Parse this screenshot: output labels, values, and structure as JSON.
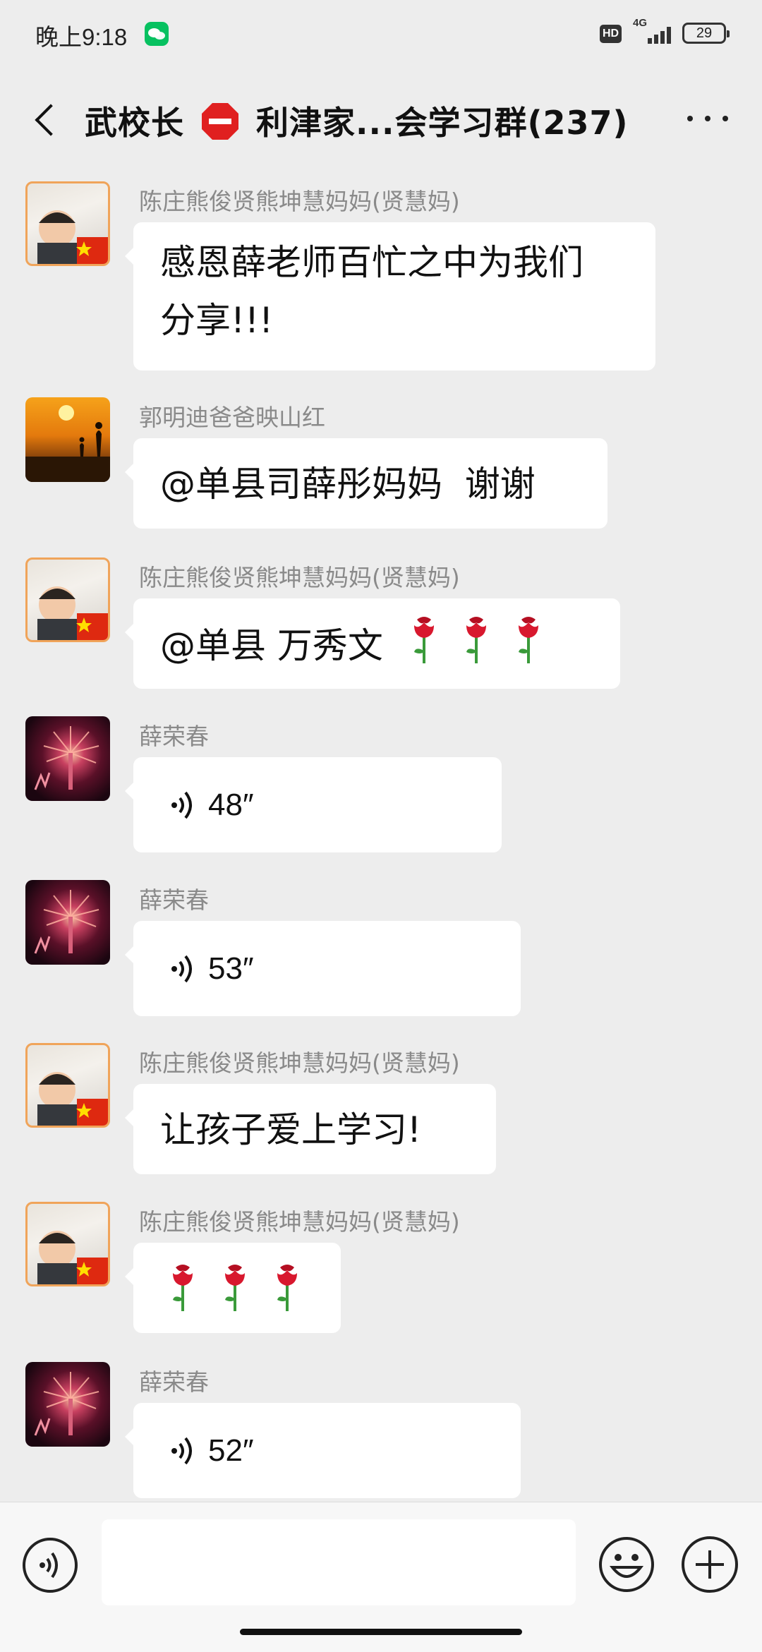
{
  "status_bar": {
    "time": "晚上9:18",
    "hd": "HD",
    "network": "4G",
    "battery": "29"
  },
  "nav": {
    "title_part1": "武校长",
    "title_part2": " 利津家...会学习群(237)",
    "title_fade": "⁄"
  },
  "messages": [
    {
      "sender": "陈庄熊俊贤熊坤慧妈妈(贤慧妈)",
      "type": "text",
      "text": "感恩薛老师百忙之中为我们\n分享!!!",
      "avatar": "kid-flag"
    },
    {
      "sender": "郭明迪爸爸映山红",
      "type": "text",
      "text": "@单县司薛彤妈妈  谢谢",
      "avatar": "sunset"
    },
    {
      "sender": "陈庄熊俊贤熊坤慧妈妈(贤慧妈)",
      "type": "text-roses",
      "text": "@单县  万秀文",
      "roses": 3,
      "avatar": "kid-flag"
    },
    {
      "sender": "薛荣春",
      "type": "voice",
      "duration": "48″",
      "avatar": "fireworks"
    },
    {
      "sender": "薛荣春",
      "type": "voice",
      "duration": "53″",
      "avatar": "fireworks"
    },
    {
      "sender": "陈庄熊俊贤熊坤慧妈妈(贤慧妈)",
      "type": "text",
      "text": "让孩子爱上学习!",
      "avatar": "kid-flag"
    },
    {
      "sender": "陈庄熊俊贤熊坤慧妈妈(贤慧妈)",
      "type": "roses",
      "roses": 3,
      "avatar": "kid-flag"
    },
    {
      "sender": "薛荣春",
      "type": "voice",
      "duration": "52″",
      "avatar": "fireworks"
    }
  ],
  "input_bar": {
    "voice_icon": "voice-input-icon",
    "emoji_icon": "emoji-icon",
    "plus_icon": "plus-icon"
  },
  "colors": {
    "background": "#ededed",
    "bubble": "#ffffff",
    "sender_text": "#8a8a8a",
    "wechat_green": "#07c160",
    "stop_red": "#e02020"
  }
}
